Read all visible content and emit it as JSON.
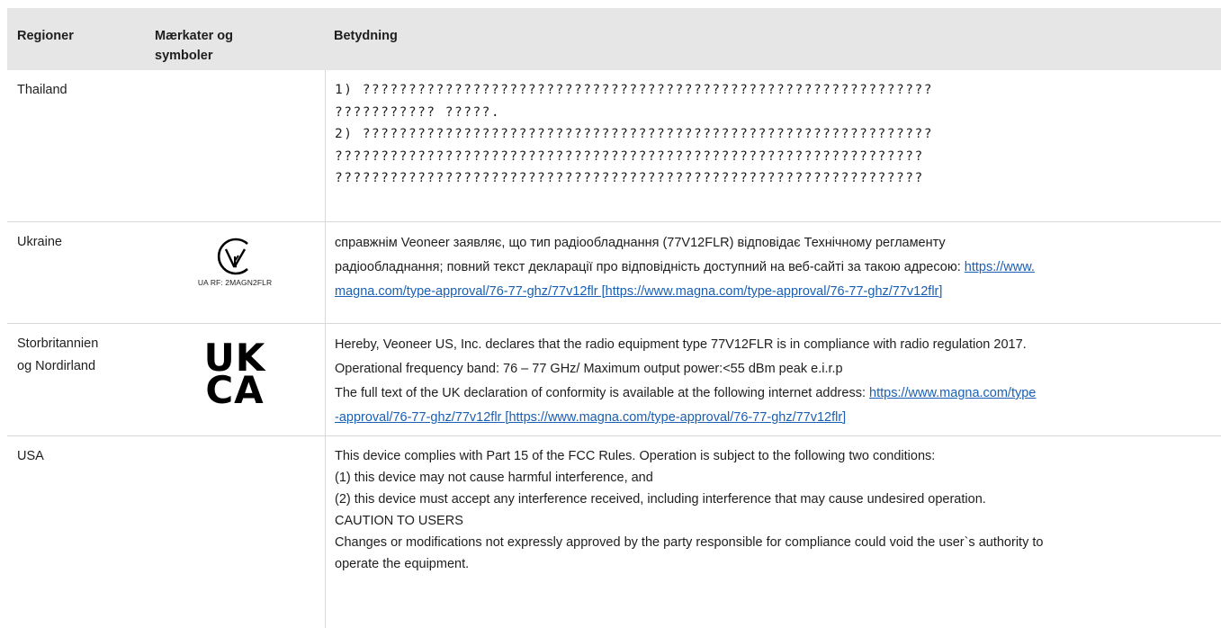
{
  "header": {
    "col1": "Regioner",
    "col2_line1": "Mærkater og",
    "col2_line2": "symboler",
    "col3": "Betydning"
  },
  "rows": {
    "thailand": {
      "region": "Thailand",
      "lines": [
        "1) ??????????????????????????????????????????????????????????????",
        "??????????? ?????.",
        "2) ??????????????????????????????????????????????????????????????",
        "????????????????????????????????????????????????????????????????",
        "????????????????????????????????????????????????????????????????"
      ]
    },
    "ukraine": {
      "region": "Ukraine",
      "mark_caption": "UA RF: 2MAGN2FLR",
      "line1": "справжнім Veoneer заявляє, що тип радіообладнання (77V12FLR) відповідає Технічному регламенту",
      "line2_text": "радіообладнання; повний текст декларації про відповідність доступний на веб-сайті за такою адресою: ",
      "line2_link": "https://www.",
      "line3_link": "magna.com/type-approval/76-77-ghz/77v12flr [https://www.magna.com/type-approval/76-77-ghz/77v12flr]"
    },
    "uk": {
      "region_line1": "Storbritannien",
      "region_line2": "og Nordirland",
      "mark_top": "UK",
      "mark_bottom": "CA",
      "line1": "Hereby, Veoneer US, Inc. declares that the radio equipment type 77V12FLR is in compliance with radio regulation 2017.",
      "line2": "Operational frequency band: 76 – 77 GHz/ Maximum output power:<55 dBm peak e.i.r.p",
      "line3_text": "The full text of the UK declaration of conformity is available at the following internet address: ",
      "line3_link": "https://www.magna.com/type",
      "line4_link": "-approval/76-77-ghz/77v12flr [https://www.magna.com/type-approval/76-77-ghz/77v12flr]"
    },
    "usa": {
      "region": "USA",
      "lines": [
        "This device complies with Part 15 of the FCC Rules. Operation is subject to the following two conditions:",
        "(1) this device may not cause harmful interference, and",
        "(2) this device must accept any interference received, including interference that may cause undesired operation.",
        "CAUTION TO USERS",
        "Changes or modifications not expressly approved by the party responsible for compliance could void the user`s authority to",
        "operate the equipment."
      ]
    }
  },
  "icons": {
    "ua_mark": "ukraine-conformity-mark-icon",
    "ukca_mark": "ukca-mark-icon"
  }
}
